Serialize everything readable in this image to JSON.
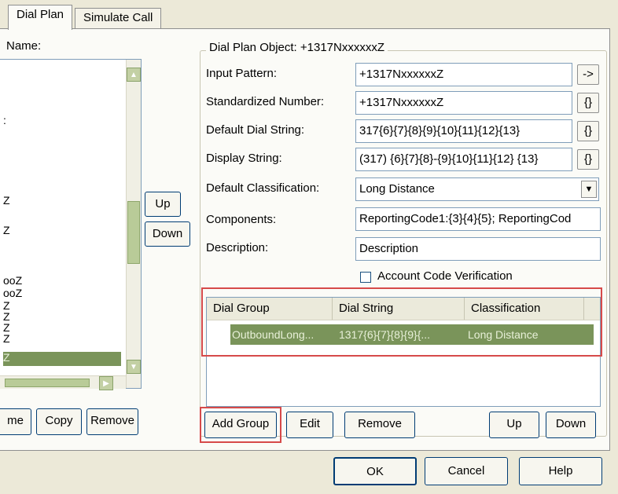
{
  "tabs": [
    {
      "label": "Dial Plan",
      "active": true
    },
    {
      "label": "Simulate Call",
      "active": false
    }
  ],
  "left_panel": {
    "name_label": "Name:",
    "list_items": [
      ":",
      "Z",
      "Z",
      "ooZ",
      "ooZ",
      "Z",
      "Z",
      "Z",
      "Z",
      "Z"
    ],
    "up_button": "Up",
    "down_button": "Down",
    "rename_button_partial": "me",
    "copy_button": "Copy",
    "remove_button": "Remove"
  },
  "dial_plan_object": {
    "title": "Dial Plan Object:  +1317NxxxxxxZ",
    "fields": [
      {
        "label": "Input Pattern:",
        "value": "+1317NxxxxxxZ",
        "button": "->"
      },
      {
        "label": "Standardized Number:",
        "value": "+1317NxxxxxxZ",
        "button": "{}"
      },
      {
        "label": "Default Dial String:",
        "value": "317{6}{7}{8}{9}{10}{11}{12}{13}",
        "button": "{}"
      },
      {
        "label": "Display String:",
        "value": "(317) {6}{7}{8}-{9}{10}{11}{12} {13}",
        "button": "{}"
      }
    ],
    "classification_label": "Default Classification:",
    "classification_value": "Long Distance",
    "components_label": "Components:",
    "components_value": "ReportingCode1:{3}{4}{5}; ReportingCod",
    "description_label": "Description:",
    "description_value": "Description",
    "account_code_label": "Account Code Verification",
    "account_code_checked": false
  },
  "dial_groups": {
    "columns": [
      "Dial Group",
      "Dial String",
      "Classification"
    ],
    "rows": [
      {
        "dial_group": "OutboundLong...",
        "dial_string": "1317{6}{7}{8}{9}{...",
        "classification": "Long Distance",
        "selected": true
      }
    ],
    "buttons": {
      "add_group": "Add Group",
      "edit": "Edit",
      "remove": "Remove",
      "up": "Up",
      "down": "Down"
    }
  },
  "dialog_buttons": {
    "ok": "OK",
    "cancel": "Cancel",
    "help": "Help"
  },
  "colors": {
    "selection": "#7a945a",
    "highlight_box": "#d64a4a",
    "scroll_accent": "#b9cb98"
  }
}
